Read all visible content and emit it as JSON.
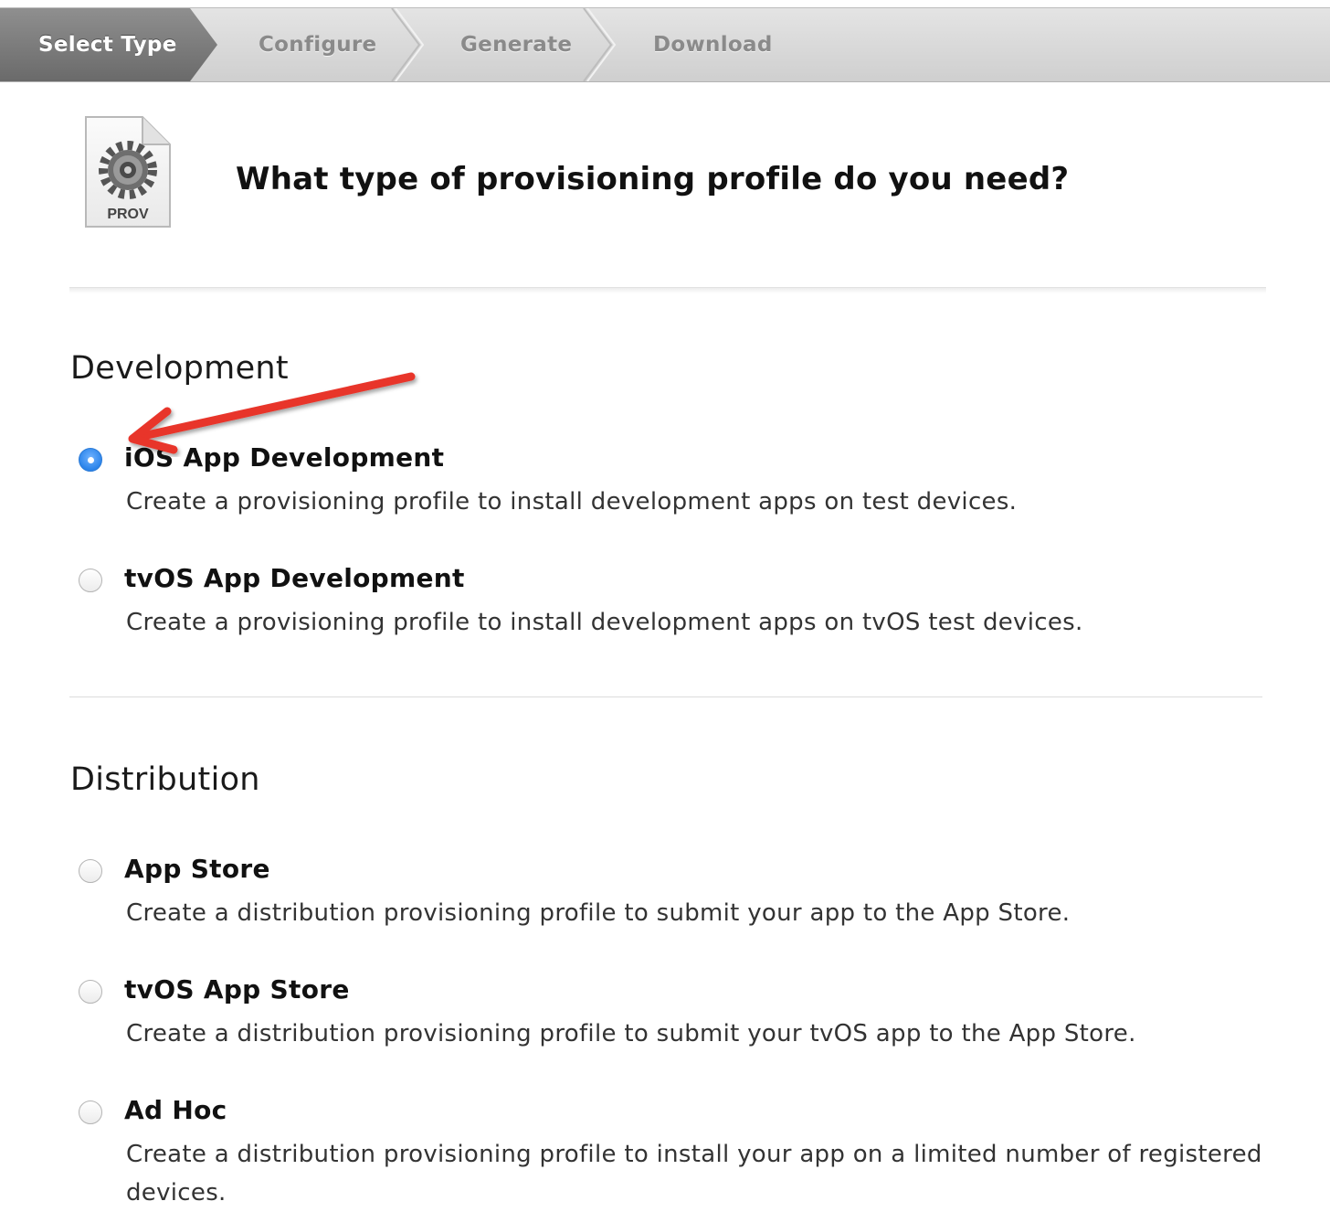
{
  "wizard": {
    "steps": [
      {
        "label": "Select Type",
        "active": true
      },
      {
        "label": "Configure",
        "active": false
      },
      {
        "label": "Generate",
        "active": false
      },
      {
        "label": "Download",
        "active": false
      }
    ]
  },
  "header": {
    "icon_label": "PROV",
    "title": "What type of provisioning profile do you need?"
  },
  "development": {
    "title": "Development",
    "options": [
      {
        "title": "iOS App Development",
        "description": "Create a provisioning profile to install development apps on test devices.",
        "selected": true
      },
      {
        "title": "tvOS App Development",
        "description": "Create a provisioning profile to install development apps on tvOS test devices.",
        "selected": false
      }
    ]
  },
  "distribution": {
    "title": "Distribution",
    "options": [
      {
        "title": "App Store",
        "description": "Create a distribution provisioning profile to submit your app to the App Store.",
        "selected": false
      },
      {
        "title": "tvOS App Store",
        "description": "Create a distribution provisioning profile to submit your tvOS app to the App Store.",
        "selected": false
      },
      {
        "title": "Ad Hoc",
        "description": "Create a distribution provisioning profile to install your app on a limited number of registered devices.",
        "selected": false
      }
    ]
  },
  "annotation": {
    "color": "#e8342a"
  },
  "colors": {
    "radio_selected": "#2b84ea",
    "wizard_active": "#7a7a7a"
  }
}
